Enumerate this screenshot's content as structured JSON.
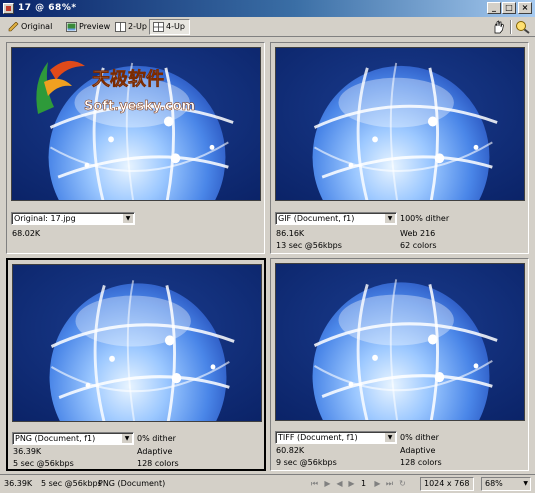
{
  "window": {
    "title": "17 @ 68%*",
    "buttons": {
      "minimize": "_",
      "maximize": "□",
      "close": "×"
    }
  },
  "toolbar": {
    "tabs": [
      {
        "label": "Original",
        "icon": "pencil-icon"
      },
      {
        "label": "Preview",
        "icon": "preview-icon"
      },
      {
        "label": "2-Up",
        "icon": "two-up-icon"
      },
      {
        "label": "4-Up",
        "icon": "four-up-icon",
        "active": true
      }
    ]
  },
  "panels": {
    "original": {
      "format": "Original: 17.jpg",
      "size": "68.02K"
    },
    "gif": {
      "format": "GIF (Document, f1)",
      "size": "86.16K",
      "time": "13 sec @56kbps",
      "dither": "100% dither",
      "palette": "Web 216",
      "colors": "62 colors"
    },
    "png": {
      "format": "PNG (Document, f1)",
      "size": "36.39K",
      "time": "5 sec @56kbps",
      "dither": "0% dither",
      "palette": "Adaptive",
      "colors": "128 colors"
    },
    "tiff": {
      "format": "TIFF (Document, f1)",
      "size": "60.82K",
      "time": "9 sec @56kbps",
      "dither": "0% dither",
      "palette": "Adaptive",
      "colors": "128 colors"
    }
  },
  "watermark": {
    "name": "天极软件",
    "url": "Soft.yesky.com"
  },
  "status": {
    "size": "36.39K",
    "time": "5 sec @56kbps",
    "format": "PNG (Document)",
    "page": "1",
    "dimensions": "1024 x 768",
    "zoom": "68%"
  },
  "colors": {
    "background": "#0e2a6e",
    "titlebar": "#0a246a",
    "chrome": "#d4d0c8"
  }
}
